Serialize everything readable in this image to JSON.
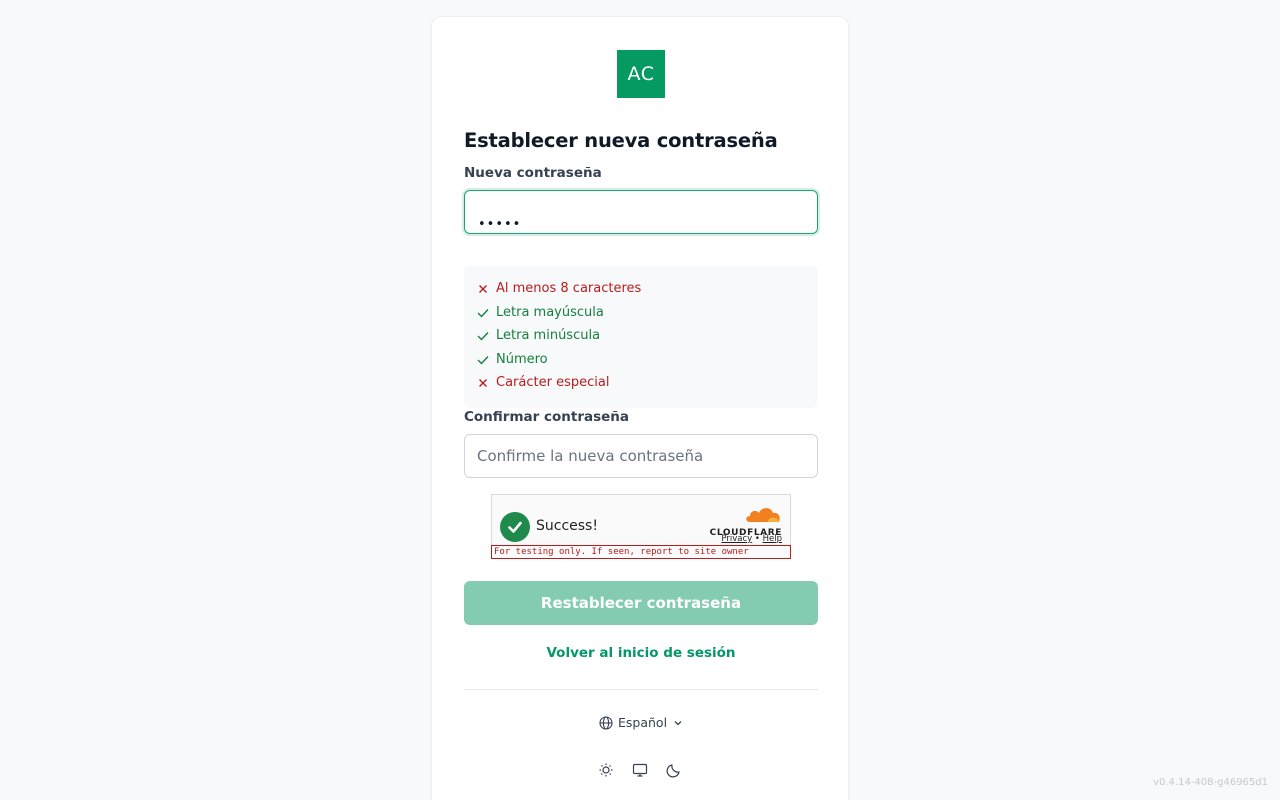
{
  "logo": {
    "text": "AC",
    "color": "#069a63"
  },
  "form": {
    "title": "Establecer nueva contraseña",
    "new_password_label": "Nueva contraseña",
    "new_password_value": "•••••",
    "requirements": [
      {
        "text": "Al menos 8 caracteres",
        "status": "fail"
      },
      {
        "text": "Letra mayúscula",
        "status": "pass"
      },
      {
        "text": "Letra minúscula",
        "status": "pass"
      },
      {
        "text": "Número",
        "status": "pass"
      },
      {
        "text": "Carácter especial",
        "status": "fail"
      }
    ],
    "confirm_label": "Confirmar contraseña",
    "confirm_placeholder": "Confirme la nueva contraseña",
    "submit_label": "Restablecer contraseña",
    "back_link": "Volver al inicio de sesión"
  },
  "turnstile": {
    "status": "Success!",
    "brand": "CLOUDFLARE",
    "privacy": "Privacy",
    "separator": "•",
    "help": "Help",
    "test_notice": "For testing only. If seen, report to site owner"
  },
  "footer": {
    "language": "Español",
    "theme_icons": [
      "sun-icon",
      "monitor-icon",
      "moon-icon"
    ],
    "version": "v0.4.14-408-g46965d1"
  },
  "colors": {
    "accent": "#059669",
    "error": "#b91c1c",
    "success": "#15803d",
    "submit_disabled": "#83cbb1"
  }
}
